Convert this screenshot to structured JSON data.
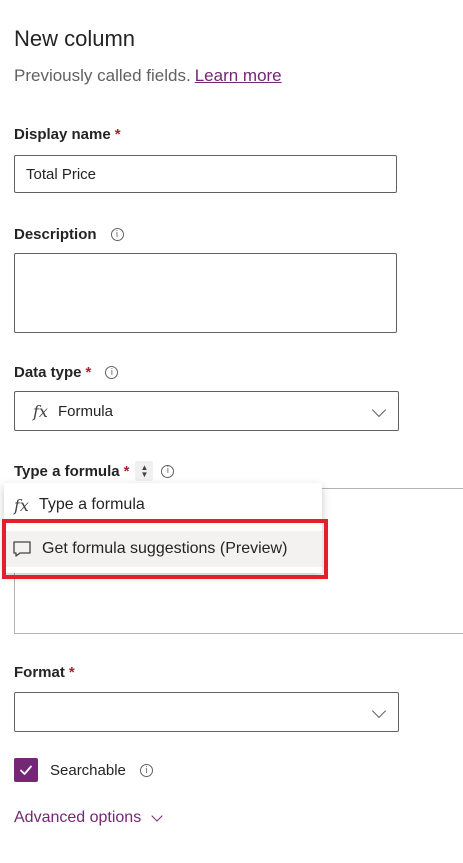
{
  "header": {
    "title": "New column",
    "subtitle": "Previously called fields.",
    "learn_more": "Learn more"
  },
  "display_name": {
    "label": "Display name",
    "required": "*",
    "value": "Total Price"
  },
  "description": {
    "label": "Description",
    "value": ""
  },
  "data_type": {
    "label": "Data type",
    "required": "*",
    "fx": "fx",
    "value": "Formula"
  },
  "formula": {
    "label": "Type a formula",
    "required": "*",
    "menu": {
      "type_formula": "Type a formula",
      "suggestions": "Get formula suggestions (Preview)"
    }
  },
  "format": {
    "label": "Format",
    "required": "*",
    "value": ""
  },
  "searchable": {
    "label": "Searchable",
    "checked": true
  },
  "advanced": {
    "label": "Advanced options"
  },
  "colors": {
    "accent": "#742774",
    "highlight": "#e0202a",
    "required": "#a4262c"
  }
}
